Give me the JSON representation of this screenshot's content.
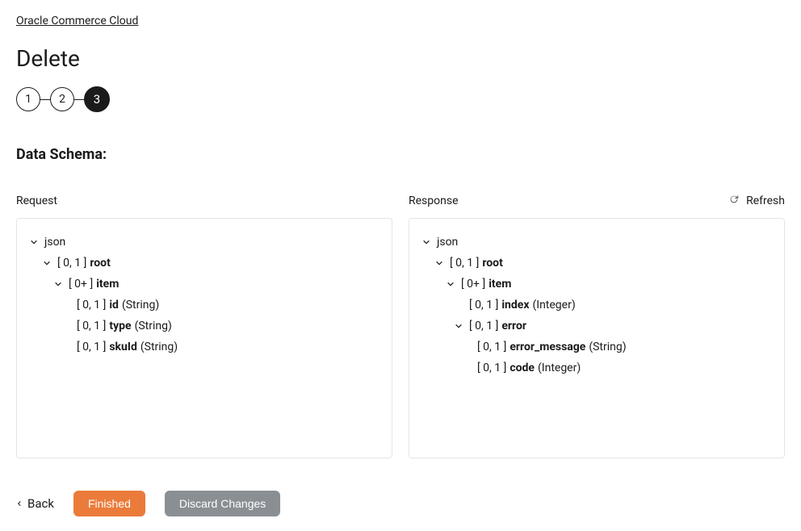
{
  "breadcrumb": "Oracle Commerce Cloud",
  "page_title": "Delete",
  "stepper": {
    "steps": [
      "1",
      "2",
      "3"
    ],
    "active_index": 2
  },
  "section_title": "Data Schema:",
  "request_label": "Request",
  "response_label": "Response",
  "refresh_label": "Refresh",
  "request_tree": {
    "root_label": "json",
    "root": {
      "card": "[ 0, 1 ]",
      "name": "root",
      "item": {
        "card": "[ 0+ ]",
        "name": "item",
        "fields": [
          {
            "card": "[ 0, 1 ]",
            "name": "id",
            "type": "(String)"
          },
          {
            "card": "[ 0, 1 ]",
            "name": "type",
            "type": "(String)"
          },
          {
            "card": "[ 0, 1 ]",
            "name": "skuId",
            "type": "(String)"
          }
        ]
      }
    }
  },
  "response_tree": {
    "root_label": "json",
    "root": {
      "card": "[ 0, 1 ]",
      "name": "root",
      "item": {
        "card": "[ 0+ ]",
        "name": "item",
        "index": {
          "card": "[ 0, 1 ]",
          "name": "index",
          "type": "(Integer)"
        },
        "error": {
          "card": "[ 0, 1 ]",
          "name": "error",
          "fields": [
            {
              "card": "[ 0, 1 ]",
              "name": "error_message",
              "type": "(String)"
            },
            {
              "card": "[ 0, 1 ]",
              "name": "code",
              "type": "(Integer)"
            }
          ]
        }
      }
    }
  },
  "footer": {
    "back": "Back",
    "finished": "Finished",
    "discard": "Discard Changes"
  }
}
